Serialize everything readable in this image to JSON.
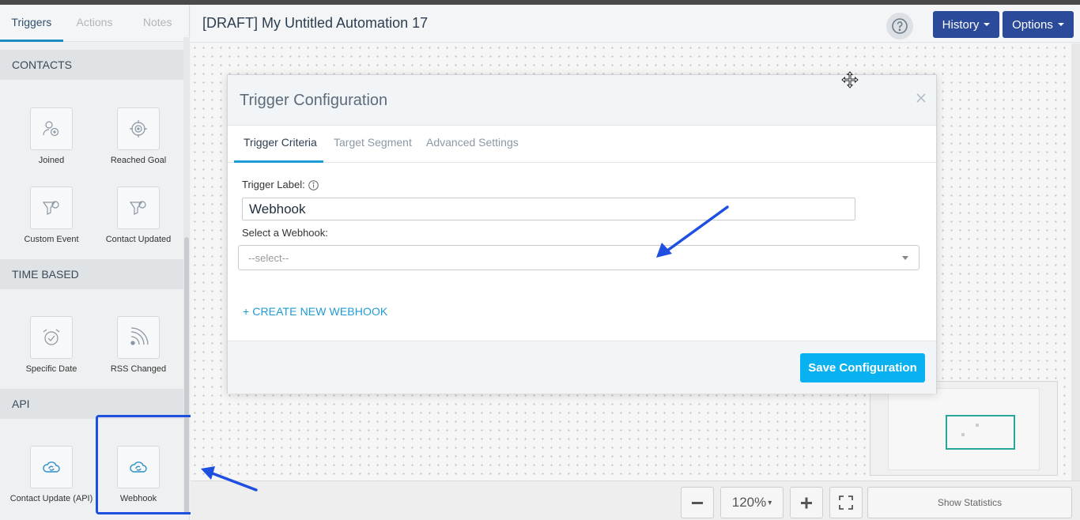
{
  "sidebar": {
    "tabs": [
      {
        "label": "Triggers"
      },
      {
        "label": "Actions"
      },
      {
        "label": "Notes"
      }
    ],
    "sections": {
      "contacts": "CONTACTS",
      "time_based": "TIME BASED",
      "api": "API"
    },
    "items": {
      "joined": "Joined",
      "reached_goal": "Reached Goal",
      "custom_event": "Custom Event",
      "contact_updated": "Contact Updated",
      "specific_date": "Specific Date",
      "rss_changed": "RSS Changed",
      "contact_update_api": "Contact Update (API)",
      "webhook": "Webhook"
    }
  },
  "header": {
    "title": "[DRAFT] My Untitled Automation 17",
    "history_label": "History",
    "options_label": "Options"
  },
  "bottom": {
    "zoom": "120%",
    "show_statistics": "Show Statistics"
  },
  "modal": {
    "title": "Trigger Configuration",
    "tabs": [
      {
        "label": "Trigger Criteria"
      },
      {
        "label": "Target Segment"
      },
      {
        "label": "Advanced Settings"
      }
    ],
    "trigger_label_text": "Trigger Label:",
    "trigger_label_value": "Webhook",
    "select_webhook_text": "Select a Webhook:",
    "select_value": "--select--",
    "create_link": "+ CREATE NEW WEBHOOK",
    "save_label": "Save Configuration"
  },
  "colors": {
    "primary_button": "#2b4a9a",
    "save_button": "#0ab1f0",
    "active_tab": "#1e9cd7",
    "annotation": "#1f4fe0"
  }
}
